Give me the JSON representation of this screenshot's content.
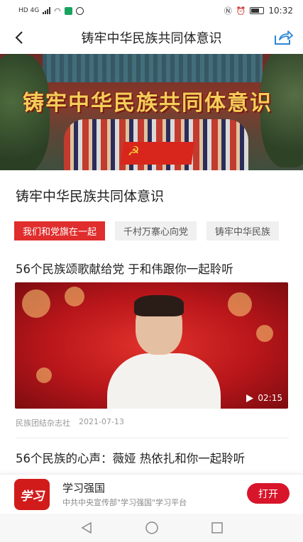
{
  "status_bar": {
    "network": "HD 4G",
    "time": "10:32"
  },
  "nav": {
    "title": "铸牢中华民族共同体意识",
    "back_icon": "back-arrow-icon",
    "share_icon": "share-icon"
  },
  "banner": {
    "overlay_text": "铸牢中华民族共同体意识"
  },
  "topic": {
    "title": "铸牢中华民族共同体意识"
  },
  "tabs": [
    {
      "label": "我们和党旗在一起",
      "active": true
    },
    {
      "label": "千村万寨心向党",
      "active": false
    },
    {
      "label": "铸牢中华民族",
      "active": false
    }
  ],
  "articles": [
    {
      "title": "56个民族颂歌献给党 于和伟跟你一起聆听",
      "duration": "02:15",
      "source": "民族团结杂志社",
      "date": "2021-07-13"
    },
    {
      "title": "56个民族的心声：薇娅 热依扎和你一起聆听"
    }
  ],
  "app_promo": {
    "logo_text": "学习",
    "name": "学习强国",
    "description": "中共中央宣传部\"学习强国\"学习平台",
    "open_label": "打开"
  },
  "colors": {
    "accent": "#e02d2d",
    "open_button": "#d8152a"
  }
}
